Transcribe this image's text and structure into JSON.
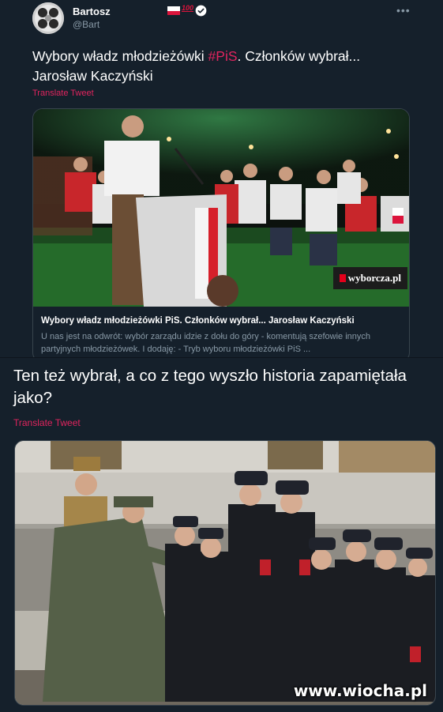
{
  "tweet1": {
    "author_name": "Bartosz",
    "handle": "@Bart",
    "badge_text": "100",
    "text_plain_1": "Wybory władz młodzieżówki ",
    "hashtag": "#PiS",
    "text_plain_2": ". Członków wybrał... Jarosław Kaczyński",
    "translate_label": "Translate Tweet",
    "card": {
      "title": "Wybory władz młodzieżówki PiS. Członków wybrał... Jarosław Kaczyński",
      "description": "U nas jest na odwrót: wybór zarządu idzie z dołu do góry - komentują szefowie innych partyjnych młodzieżówek. I dodaję: - Tryb wyboru młodzieżówki PiS ...",
      "source_logo": "wyborcza.pl"
    }
  },
  "tweet2": {
    "text": "Ten też wybrał, a co z tego wyszło historia zapamiętała jako?",
    "translate_label": "Translate Tweet",
    "watermark": "www.wiocha.pl"
  },
  "colors": {
    "background": "#15202b",
    "accent": "#e0245e",
    "secondary_text": "#8899a6",
    "border": "#38444d",
    "verified": "#ffffff"
  },
  "icons": {
    "more": "more-horizontal-icon",
    "verified": "verified-badge-icon",
    "flag": "poland-flag-icon"
  }
}
